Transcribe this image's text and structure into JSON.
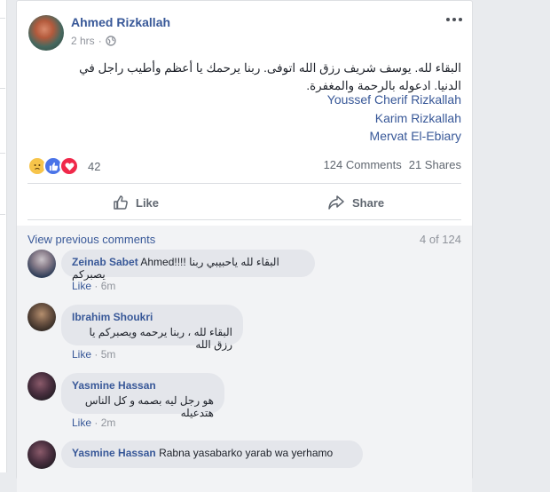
{
  "post": {
    "author": "Ahmed Rizkallah",
    "time": "2 hrs",
    "privacy_icon": "globe-icon",
    "text": "البقاء لله. يوسف شريف رزق الله اتوفى. ربنا يرحمك يا أعظم وأطيب راجل في الدنيا. ادعوله بالرحمة والمغفرة.",
    "tags": [
      "Youssef Cherif Rizkallah",
      "Karim Rizkallah",
      "Mervat El-Ebiary"
    ],
    "reaction_count": "42",
    "comments_count": "124 Comments",
    "shares_count": "21 Shares",
    "reactions": [
      "sad-reaction-icon",
      "like-reaction-icon",
      "love-reaction-icon"
    ]
  },
  "actions": {
    "like_label": "Like",
    "share_label": "Share"
  },
  "comments_header": {
    "view_previous": "View previous comments",
    "count": "4 of 124"
  },
  "comments": [
    {
      "name": "Zeinab Sabet",
      "text_ltr": "Ahmed!!!!",
      "text_rtl": "البقاء لله ياحبيبي ربنا يصبركم",
      "like": "Like",
      "time": "6m"
    },
    {
      "name": "Ibrahim Shoukri",
      "text_rtl": "البقاء لله ، ربنا يرحمه ويصبركم يا رزق الله",
      "like": "Like",
      "time": "5m"
    },
    {
      "name": "Yasmine Hassan",
      "text_rtl": "هو رجل ليه بصمه و كل الناس هتدعيله",
      "like": "Like",
      "time": "2m"
    },
    {
      "name": "Yasmine Hassan",
      "text_ltr": "Rabna yasabarko yarab wa yerhamo"
    }
  ],
  "colors": {
    "link": "#385898",
    "muted": "#90949c",
    "bubble": "#e4e6eb",
    "background": "#e9ebee"
  }
}
